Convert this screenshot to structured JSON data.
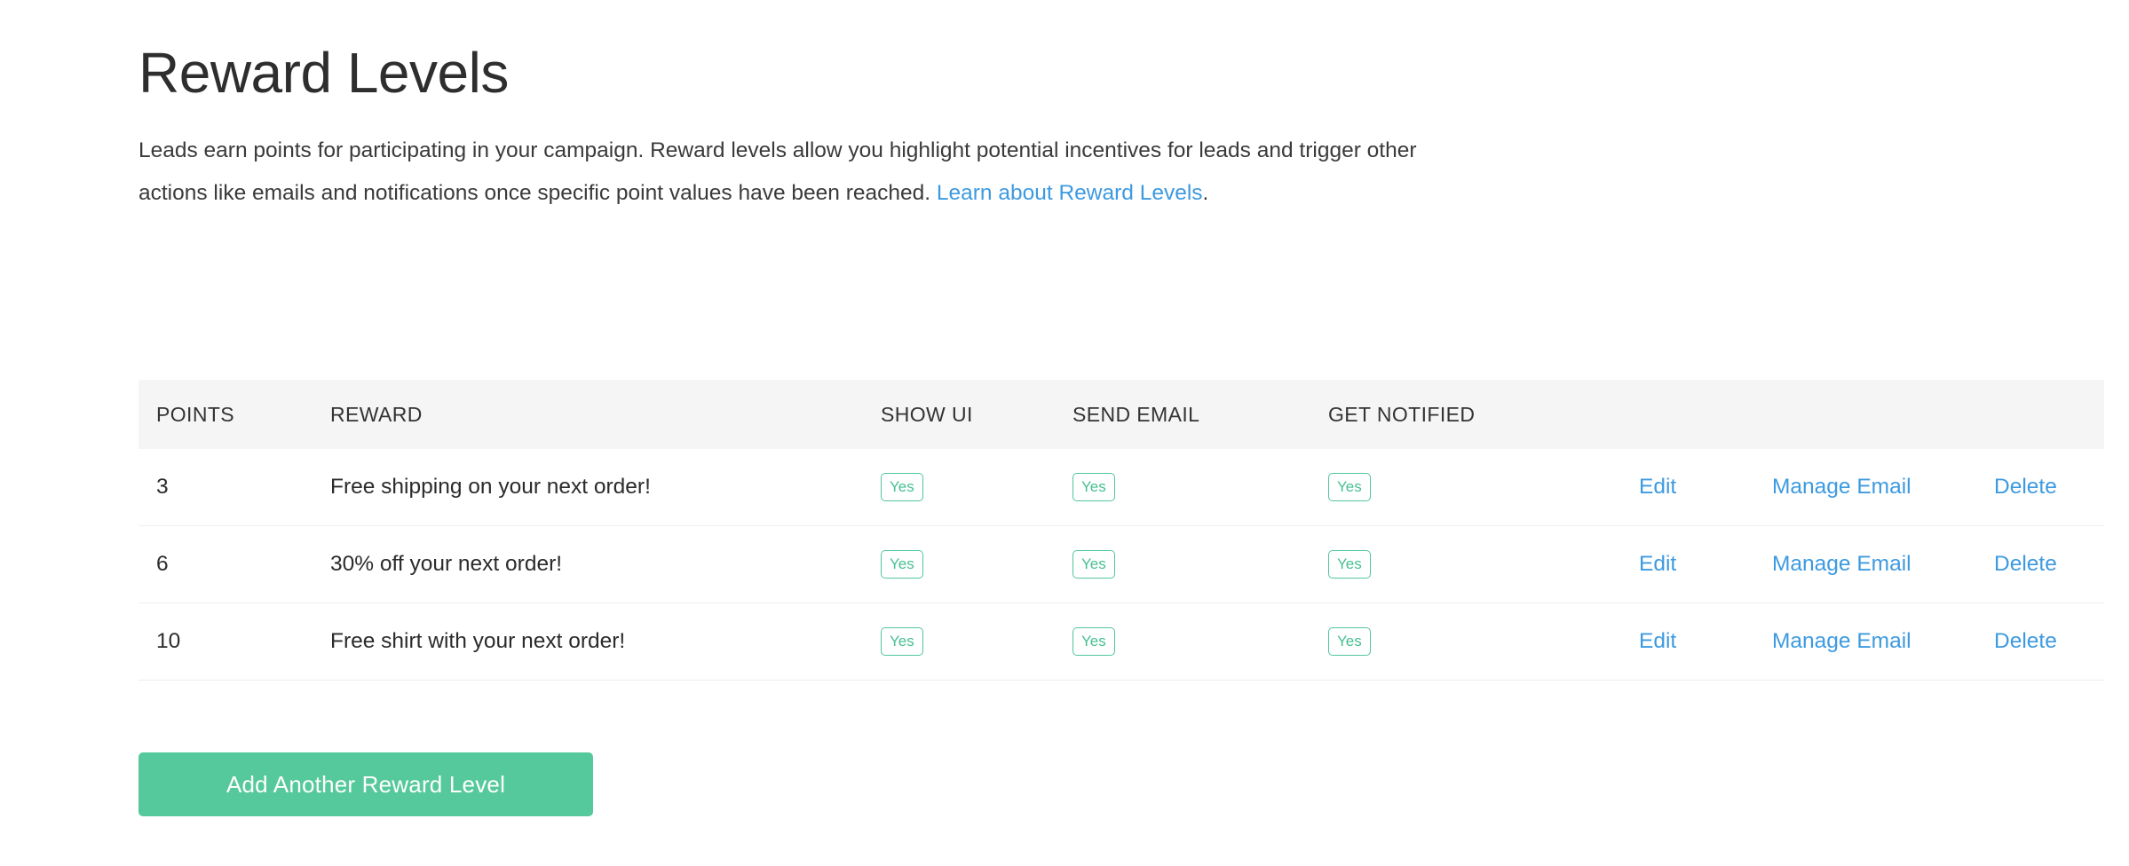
{
  "page": {
    "title": "Reward Levels",
    "intro_text_before_link": "Leads earn points for participating in your campaign. Reward levels allow you highlight potential incentives for leads and trigger other actions like emails and notifications once specific point values have been reached. ",
    "intro_link_label": "Learn about Reward Levels",
    "intro_text_after_link": "."
  },
  "table": {
    "columns": [
      {
        "key": "points",
        "label": "POINTS"
      },
      {
        "key": "reward",
        "label": "REWARD"
      },
      {
        "key": "show_ui",
        "label": "SHOW UI"
      },
      {
        "key": "send_email",
        "label": "SEND EMAIL"
      },
      {
        "key": "get_notified",
        "label": "GET NOTIFIED"
      },
      {
        "key": "action_edit",
        "label": ""
      },
      {
        "key": "action_manage",
        "label": ""
      },
      {
        "key": "action_delete",
        "label": ""
      }
    ],
    "rows": [
      {
        "points": "3",
        "reward": "Free shipping on your next order!",
        "show_ui": "Yes",
        "send_email": "Yes",
        "get_notified": "Yes",
        "edit_label": "Edit",
        "manage_label": "Manage Email",
        "delete_label": "Delete"
      },
      {
        "points": "6",
        "reward": "30% off your next order!",
        "show_ui": "Yes",
        "send_email": "Yes",
        "get_notified": "Yes",
        "edit_label": "Edit",
        "manage_label": "Manage Email",
        "delete_label": "Delete"
      },
      {
        "points": "10",
        "reward": "Free shirt with your next order!",
        "show_ui": "Yes",
        "send_email": "Yes",
        "get_notified": "Yes",
        "edit_label": "Edit",
        "manage_label": "Manage Email",
        "delete_label": "Delete"
      }
    ]
  },
  "footer": {
    "add_button_label": "Add Another Reward Level"
  },
  "colors": {
    "link_blue": "#3d9ae0",
    "accent_green": "#55c99b",
    "badge_green": "#47bf92",
    "header_bg": "#f5f5f5",
    "row_border": "#efefef",
    "text": "#2b2b2b"
  }
}
